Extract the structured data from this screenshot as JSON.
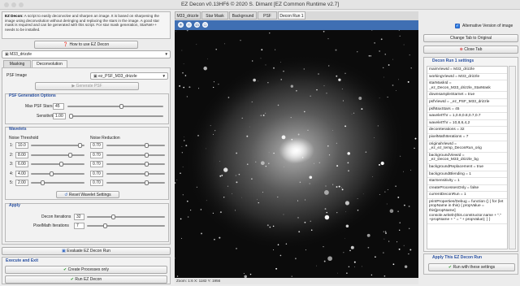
{
  "window": {
    "title": "EZ Decon v0.13HF6 © 2020 S. Dimant [EZ Common Runtime v2.7]"
  },
  "description": {
    "bold": "EZ Decon:",
    "text": " A script to easily deconvolve and sharpen an image. It is based on sharpening the image using deconvolution without deringing and replacing the stars in the image. A good star mask is required and can be generated with this script. For star mask generation, StarNet++ needs to be installed."
  },
  "how_to_button": "How to use EZ Decon",
  "image_select": "M33_drizzle",
  "tabs": [
    "Masking",
    "Deconvolution"
  ],
  "psf": {
    "label": "PSF Image",
    "value": "ez_PSF_M33_drizzle",
    "generate": "Generate PSF"
  },
  "psf_options": {
    "title": "PSF Generation Options",
    "max_label": "Max PSF Stars",
    "max_value": "45",
    "sens_label": "Sensitivity",
    "sens_value": "1.00"
  },
  "wavelets": {
    "title": "Wavelets",
    "noise_threshold": "Noise Threshold",
    "noise_reduction": "Noise Reduction",
    "rows": [
      {
        "idx": "1:",
        "th": "10.0",
        "th_frac": 0.95,
        "nr": "0.70",
        "nr_frac": 0.7
      },
      {
        "idx": "2:",
        "th": "8.00",
        "th_frac": 0.76,
        "nr": "0.70",
        "nr_frac": 0.7
      },
      {
        "idx": "3:",
        "th": "6.00",
        "th_frac": 0.57,
        "nr": "0.70",
        "nr_frac": 0.7
      },
      {
        "idx": "4:",
        "th": "4.00",
        "th_frac": 0.38,
        "nr": "0.70",
        "nr_frac": 0.7
      },
      {
        "idx": "5:",
        "th": "2.00",
        "th_frac": 0.19,
        "nr": "0.70",
        "nr_frac": 0.7
      }
    ],
    "reset": "Reset Wavelet Settings"
  },
  "apply": {
    "title": "Apply",
    "decon_label": "Decon Iterations",
    "decon_value": "32",
    "pixelmath_label": "PixelMath Iterations",
    "pixelmath_value": "7"
  },
  "evaluate_button": "Evaluate EZ Decon Run",
  "execute": {
    "title": "Execute and Exit",
    "create_processes": "Create Processes only",
    "run": "Run EZ Decon"
  },
  "viewer": {
    "tabs": [
      "M33_drizzle",
      "Star Mask",
      "Background",
      "PSF",
      "Decon Run 1"
    ],
    "active_tab": 4,
    "tools": [
      "+",
      "-",
      "1:1",
      "↔"
    ],
    "status": "Zoom: 1:6   X: 1182   Y: 1956"
  },
  "right": {
    "alt_label": "Alternative Version of image",
    "change_tab": "Change Tab to Original",
    "close_tab": "Close Tab",
    "settings_title": "Decon Run 1 settings",
    "settings": [
      "mainViewId = M33_drizzle",
      "workingViewId = M33_drizzle",
      "starMaskId = _ez_Decon_M33_drizzle_StarMask",
      "downsampleStarnet = true",
      "psfViewId = _ez_PSF_M33_drizzle",
      "psfMaxStars = 45",
      "waveletThr = 1,0.9,0.8,0.7,0.7",
      "waveletThr = 10,8,6,4,2",
      "deconIterations = 32",
      "pixelMathIterations = 7",
      "originalViewId = _ez_ez_temp_DeconRun_orig",
      "backgroundViewId = _ez_Decon_M33_drizzle_bg",
      "backgroundReplacement = true",
      "backgroundBlending = 1",
      "starSensitivity = 1",
      "createProcessesOnly = false",
      "currentDeconRun = 1",
      "printProperties/Debug = function () { for (let propName in this) { propValue = this[propName] console.writeln(this.constructor.name + \".\" +propName + \" = \" + propValue); } }"
    ],
    "apply_title": "Apply This EZ Decon Run",
    "run_settings": "Run with these settings"
  }
}
